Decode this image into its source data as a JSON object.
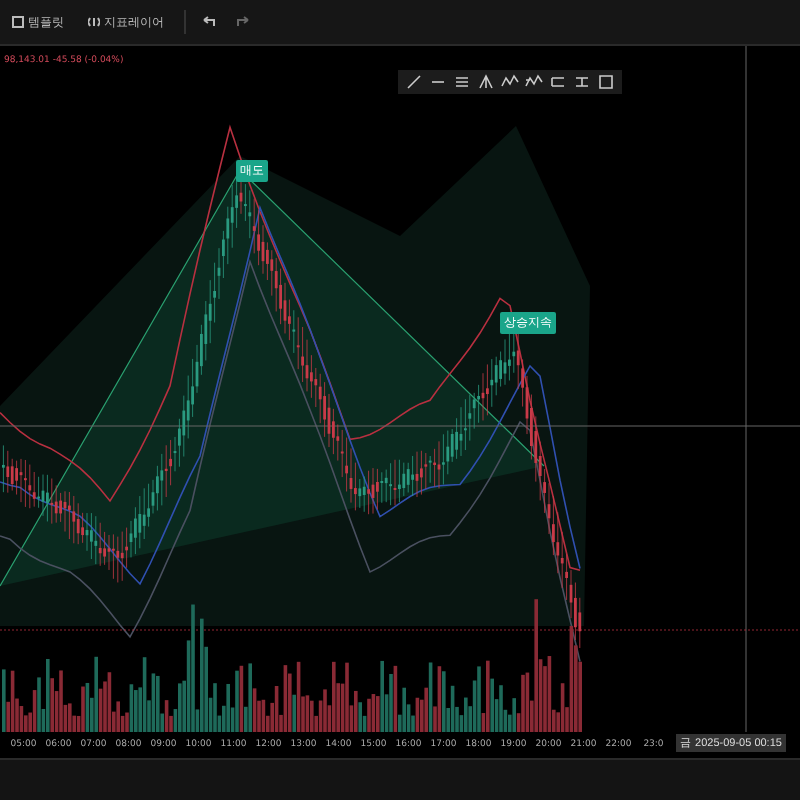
{
  "toolbar": {
    "items": [
      {
        "kind": "template",
        "label": "템플릿"
      },
      {
        "kind": "indicator",
        "label": "지표레이어"
      },
      {
        "kind": "undo"
      },
      {
        "kind": "redo"
      }
    ]
  },
  "price_legend": "98,143.01  -45.58 (-0.04%)",
  "drawing_tools": [
    {
      "kind": "line"
    },
    {
      "kind": "horizontal"
    },
    {
      "kind": "fib"
    },
    {
      "kind": "pitchfork"
    },
    {
      "kind": "wave"
    },
    {
      "kind": "wave2"
    },
    {
      "kind": "channel"
    },
    {
      "kind": "range"
    },
    {
      "kind": "rect"
    }
  ],
  "signals": [
    {
      "label": "매도",
      "kind": "top"
    },
    {
      "label": "상승지속",
      "kind": "right"
    }
  ],
  "time_axis": {
    "ticks": [
      "05:00",
      "06:00",
      "07:00",
      "08:00",
      "09:00",
      "10:00",
      "11:00",
      "12:00",
      "13:00",
      "14:00",
      "15:00",
      "16:00",
      "17:00",
      "18:00",
      "19:00",
      "20:00",
      "21:00",
      "22:00",
      "23:0"
    ],
    "crosshair_label": "금 2025-09-05  00:15"
  }
}
